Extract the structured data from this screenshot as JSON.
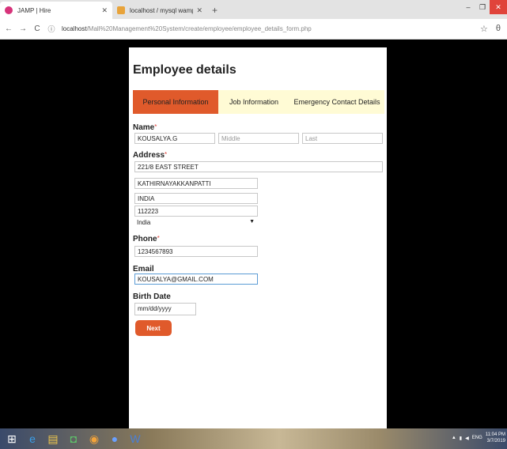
{
  "browser": {
    "tabs": [
      {
        "label": "JAMP | Hire",
        "active": true
      },
      {
        "label": "localhost / mysql wampserver / ...",
        "active": false
      }
    ],
    "new_tab": "+",
    "url_host": "localhost",
    "url_path": "/Mall%20Management%20System/create/employee/employee_details_form.php",
    "window_controls": [
      "–",
      "❐",
      "✕"
    ]
  },
  "form": {
    "title": "Employee details",
    "tabs": [
      "Personal Information",
      "Job Information",
      "Emergency Contact Details"
    ],
    "name_label": "Name",
    "required_mark": "*",
    "name_first": "KOUSALYA.G",
    "name_middle_placeholder": "Middle",
    "name_last_placeholder": "Last",
    "address_label": "Address",
    "address_line1": "221/8 EAST STREET",
    "address_line2": "KATHIRNAYAKKANPATTI",
    "address_state": "INDIA",
    "address_zip": "112223",
    "address_country": "India",
    "phone_label": "Phone",
    "phone_value": "1234567893",
    "email_label": "Email",
    "email_value": "KOUSALYA@GMAIL.COM",
    "birth_label": "Birth Date",
    "birth_placeholder": "mm/dd/yyyy",
    "next_label": "Next"
  },
  "taskbar": {
    "clock_time": "11:04 PM",
    "clock_date": "3/7/2019",
    "lang": "ENG"
  },
  "colors": {
    "accent": "#e05a2b",
    "tab_bg": "#fffbd5"
  }
}
